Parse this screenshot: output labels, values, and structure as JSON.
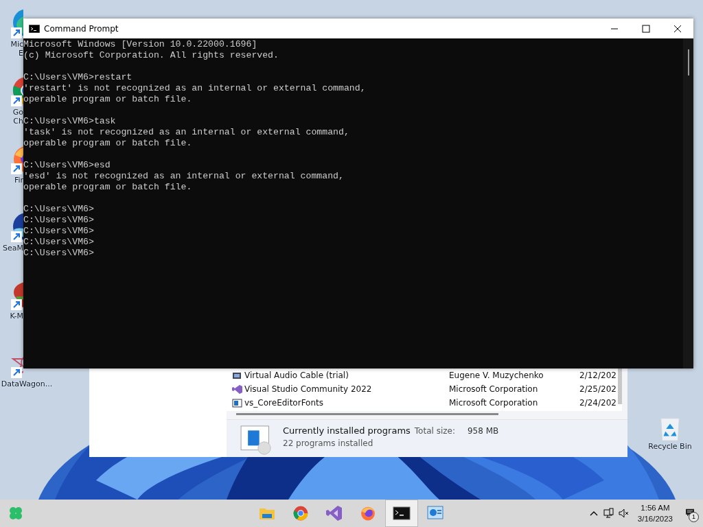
{
  "desktop": {
    "icons": [
      {
        "kind": "edge",
        "lines": [
          "Mic",
          "E"
        ]
      },
      {
        "kind": "chrome",
        "lines": [
          "Go",
          "Ch"
        ]
      },
      {
        "kind": "firefox",
        "lines": [
          "Fir"
        ]
      },
      {
        "kind": "seamonkey",
        "lines": [
          "SeaM"
        ]
      },
      {
        "kind": "kmplayer",
        "lines": [
          "K-M"
        ]
      },
      {
        "kind": "datawagon",
        "lines": [
          "DataWagon..."
        ]
      }
    ],
    "recycle_bin": {
      "label": "Recycle Bin"
    }
  },
  "programs_window": {
    "rows": [
      {
        "kind": "audio",
        "name": "Virtual Audio Cable (trial)",
        "publisher": "Eugene V. Muzychenko",
        "date": "2/12/202"
      },
      {
        "kind": "vs",
        "name": "Visual Studio Community 2022",
        "publisher": "Microsoft Corporation",
        "date": "2/25/202"
      },
      {
        "kind": "fonts",
        "name": "vs_CoreEditorFonts",
        "publisher": "Microsoft Corporation",
        "date": "2/24/202"
      }
    ],
    "summary": {
      "title": "Currently installed programs",
      "size_label": "Total size:",
      "size": "958 MB",
      "count": "22 programs installed"
    }
  },
  "console": {
    "title": "Command Prompt",
    "blocks": [
      [
        "Microsoft Windows [Version 10.0.22000.1696]",
        "(c) Microsoft Corporation. All rights reserved."
      ],
      [
        "C:\\Users\\VM6>restart",
        "'restart' is not recognized as an internal or external command,",
        "operable program or batch file."
      ],
      [
        "C:\\Users\\VM6>task",
        "'task' is not recognized as an internal or external command,",
        "operable program or batch file."
      ],
      [
        "C:\\Users\\VM6>esd",
        "'esd' is not recognized as an internal or external command,",
        "operable program or batch file."
      ],
      [
        "C:\\Users\\VM6>",
        "C:\\Users\\VM6>",
        "C:\\Users\\VM6>",
        "C:\\Users\\VM6>",
        "C:\\Users\\VM6>"
      ]
    ]
  },
  "taskbar": {
    "apps": [
      {
        "kind": "explorer",
        "selected": false
      },
      {
        "kind": "chrome",
        "selected": false
      },
      {
        "kind": "vs",
        "selected": false
      },
      {
        "kind": "firefox",
        "selected": false
      },
      {
        "kind": "cmd",
        "selected": true
      },
      {
        "kind": "programs",
        "selected": false
      }
    ],
    "time": "1:56 AM",
    "date": "3/16/2023",
    "notifications": "1"
  }
}
